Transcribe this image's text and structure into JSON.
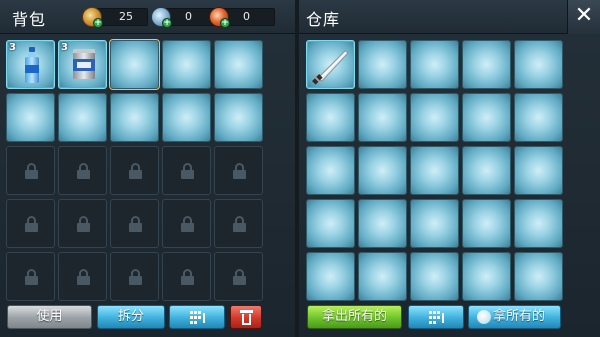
{
  "left_panel": {
    "title": "背包",
    "currencies": [
      {
        "icon": "silver-coin-icon",
        "value": "25"
      },
      {
        "icon": "diamond-coin-icon",
        "value": "0"
      },
      {
        "icon": "red-coin-icon",
        "value": "0"
      }
    ],
    "slots": [
      {
        "state": "open",
        "item": "water-bottle-icon",
        "count": "3"
      },
      {
        "state": "open",
        "item": "canned-food-icon",
        "count": "3"
      },
      {
        "state": "open",
        "selected": true
      },
      {
        "state": "open"
      },
      {
        "state": "open"
      },
      {
        "state": "open"
      },
      {
        "state": "open"
      },
      {
        "state": "open"
      },
      {
        "state": "open"
      },
      {
        "state": "open"
      },
      {
        "state": "locked"
      },
      {
        "state": "locked"
      },
      {
        "state": "locked"
      },
      {
        "state": "locked"
      },
      {
        "state": "locked"
      },
      {
        "state": "locked"
      },
      {
        "state": "locked"
      },
      {
        "state": "locked"
      },
      {
        "state": "locked"
      },
      {
        "state": "locked"
      },
      {
        "state": "locked"
      },
      {
        "state": "locked"
      },
      {
        "state": "locked"
      },
      {
        "state": "locked"
      },
      {
        "state": "locked"
      }
    ],
    "buttons": {
      "use": "使用",
      "split": "拆分"
    }
  },
  "right_panel": {
    "title": "仓库",
    "slots": [
      {
        "state": "open",
        "item": "knife-icon"
      },
      {
        "state": "open"
      },
      {
        "state": "open"
      },
      {
        "state": "open"
      },
      {
        "state": "open"
      },
      {
        "state": "open"
      },
      {
        "state": "open"
      },
      {
        "state": "open"
      },
      {
        "state": "open"
      },
      {
        "state": "open"
      },
      {
        "state": "open"
      },
      {
        "state": "open"
      },
      {
        "state": "open"
      },
      {
        "state": "open"
      },
      {
        "state": "open"
      },
      {
        "state": "open"
      },
      {
        "state": "open"
      },
      {
        "state": "open"
      },
      {
        "state": "open"
      },
      {
        "state": "open"
      },
      {
        "state": "open"
      },
      {
        "state": "open"
      },
      {
        "state": "open"
      },
      {
        "state": "open"
      },
      {
        "state": "open"
      }
    ],
    "buttons": {
      "take_out_all": "拿出所有的",
      "take_all": "拿所有的"
    }
  },
  "colors": {
    "background": "#1f2a33",
    "slot_glow": "#9bd3e5",
    "selected_outline": "#e4c75a",
    "use_button": "#9aa1a6",
    "blue_button": "#3fb0dc",
    "green_button": "#6fc42b",
    "red_button": "#d1392a"
  }
}
